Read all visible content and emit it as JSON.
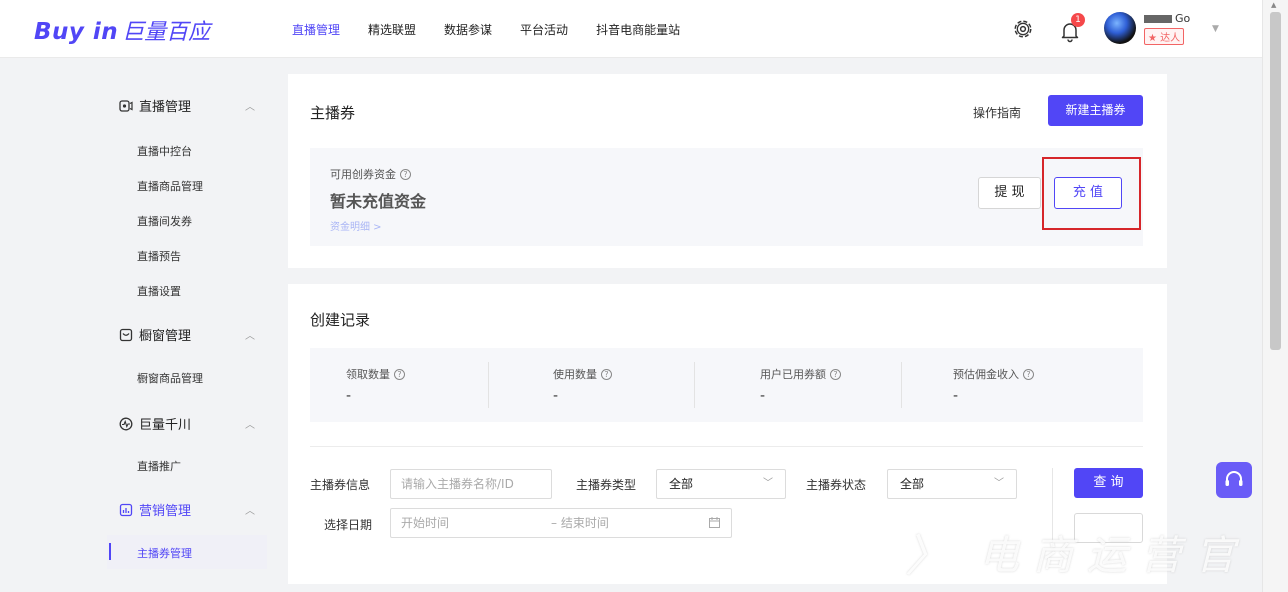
{
  "brand": {
    "logo_en": "Buy in",
    "logo_cn": "巨量百应"
  },
  "nav": {
    "items": [
      "直播管理",
      "精选联盟",
      "数据参谋",
      "平台活动",
      "抖音电商能量站"
    ]
  },
  "header": {
    "notification_count": "1",
    "user_name": "Go",
    "user_badge": "达人"
  },
  "sidebar": {
    "groups": [
      {
        "label": "直播管理",
        "items": [
          "直播中控台",
          "直播商品管理",
          "直播间发券",
          "直播预告",
          "直播设置"
        ]
      },
      {
        "label": "橱窗管理",
        "items": [
          "橱窗商品管理"
        ]
      },
      {
        "label": "巨量千川",
        "items": [
          "直播推广"
        ]
      },
      {
        "label": "营销管理",
        "items": [
          "主播券管理"
        ]
      }
    ]
  },
  "coupon_card": {
    "title": "主播券",
    "guide": "操作指南",
    "new_button": "新建主播券",
    "fund_label": "可用创券资金",
    "fund_value": "暂未充值资金",
    "fund_link": "资金明细 >",
    "withdraw": "提 现",
    "recharge": "充 值"
  },
  "records": {
    "title": "创建记录",
    "stats": [
      {
        "label": "领取数量",
        "value": "-"
      },
      {
        "label": "使用数量",
        "value": "-"
      },
      {
        "label": "用户已用券额",
        "value": "-"
      },
      {
        "label": "预估佣金收入",
        "value": "-"
      }
    ]
  },
  "filters": {
    "coupon_info_label": "主播券信息",
    "coupon_info_placeholder": "请输入主播券名称/ID",
    "coupon_type_label": "主播券类型",
    "coupon_type_value": "全部",
    "coupon_status_label": "主播券状态",
    "coupon_status_value": "全部",
    "query_button": "查 询",
    "date_label": "选择日期",
    "start_placeholder": "开始时间",
    "end_placeholder": "– 结束时间"
  },
  "watermark": {
    "text": "电商运营官"
  },
  "colors": {
    "accent": "#5146f6",
    "highlight": "#d6262a",
    "badge": "#f5484a"
  }
}
